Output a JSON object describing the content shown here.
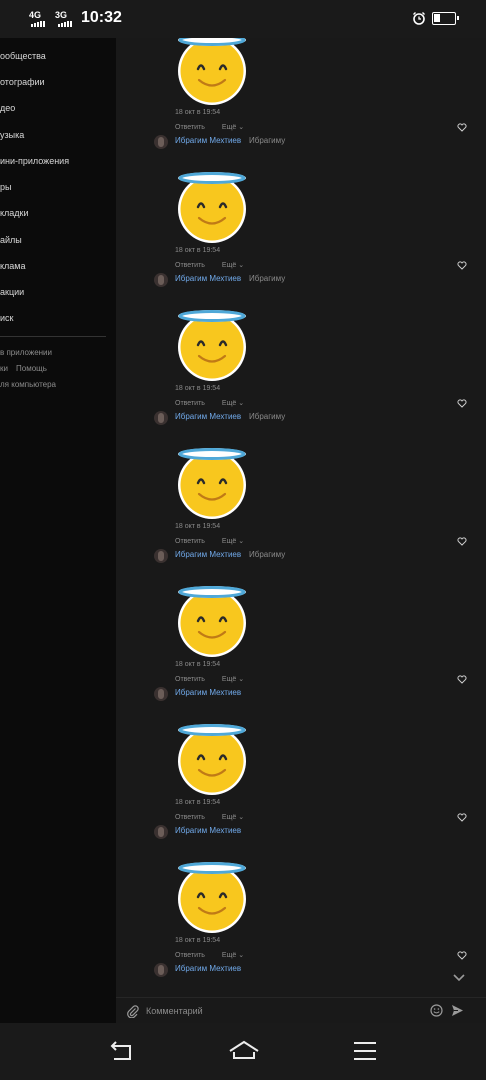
{
  "status_bar": {
    "network1": "4G",
    "network2": "3G",
    "time": "10:32",
    "alarm_icon": "alarm-clock-icon",
    "battery_icon": "battery-low-icon"
  },
  "menu": {
    "items": [
      "ообщества",
      "отографии",
      "део",
      "узыка",
      "ини-приложения",
      "ры",
      "кладки",
      "айлы",
      "клама",
      "акции",
      "иск"
    ],
    "footer_line1": "в приложении",
    "footer_line2a": "ки",
    "footer_line2b": "Помощь",
    "footer_line3": "ля компьютера"
  },
  "feed": {
    "sticker_icon": "smiling-face-with-halo-sticker",
    "messages": [
      {
        "date": "18 окт в 19:54",
        "reply": "Ответить",
        "more": "Ещё",
        "next_author": "Ибрагим Мехтиев",
        "next_reply_to": "Ибрагиму"
      },
      {
        "date": "18 окт в 19:54",
        "reply": "Ответить",
        "more": "Ещё",
        "next_author": "Ибрагим Мехтиев",
        "next_reply_to": "Ибрагиму"
      },
      {
        "date": "18 окт в 19:54",
        "reply": "Ответить",
        "more": "Ещё",
        "next_author": "Ибрагим Мехтиев",
        "next_reply_to": "Ибрагиму"
      },
      {
        "date": "18 окт в 19:54",
        "reply": "Ответить",
        "more": "Ещё",
        "next_author": "Ибрагим Мехтиев",
        "next_reply_to": "Ибрагиму"
      },
      {
        "date": "18 окт в 19:54",
        "reply": "Ответить",
        "more": "Ещё",
        "next_author": "Ибрагим Мехтиев",
        "next_reply_to": ""
      },
      {
        "date": "18 окт в 19:54",
        "reply": "Ответить",
        "more": "Ещё",
        "next_author": "Ибрагим Мехтиев",
        "next_reply_to": ""
      },
      {
        "date": "18 окт в 19:54",
        "reply": "Ответить",
        "more": "Ещё",
        "next_author": "Ибрагим Мехтиев",
        "next_reply_to": ""
      }
    ]
  },
  "comment_bar": {
    "placeholder": "Комментарий",
    "attach_icon": "paperclip-icon",
    "emoji_icon": "smile-icon",
    "send_icon": "send-icon"
  },
  "nav_bar": {
    "back_icon": "back-icon",
    "home_icon": "home-icon",
    "menu_icon": "menu-icon"
  },
  "colors": {
    "background": "#191919",
    "menu_background": "#0b0b0b",
    "link": "#71aaeb",
    "muted": "#8a8a8a"
  }
}
